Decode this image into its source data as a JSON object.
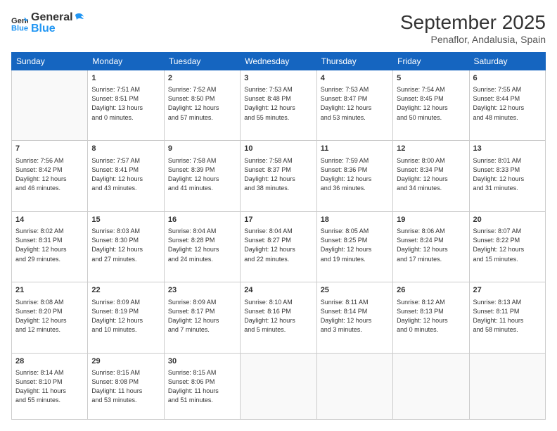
{
  "logo": {
    "general": "General",
    "blue": "Blue"
  },
  "header": {
    "month": "September 2025",
    "location": "Penaflor, Andalusia, Spain"
  },
  "days_of_week": [
    "Sunday",
    "Monday",
    "Tuesday",
    "Wednesday",
    "Thursday",
    "Friday",
    "Saturday"
  ],
  "weeks": [
    [
      {
        "day": "",
        "info": ""
      },
      {
        "day": "1",
        "info": "Sunrise: 7:51 AM\nSunset: 8:51 PM\nDaylight: 13 hours\nand 0 minutes."
      },
      {
        "day": "2",
        "info": "Sunrise: 7:52 AM\nSunset: 8:50 PM\nDaylight: 12 hours\nand 57 minutes."
      },
      {
        "day": "3",
        "info": "Sunrise: 7:53 AM\nSunset: 8:48 PM\nDaylight: 12 hours\nand 55 minutes."
      },
      {
        "day": "4",
        "info": "Sunrise: 7:53 AM\nSunset: 8:47 PM\nDaylight: 12 hours\nand 53 minutes."
      },
      {
        "day": "5",
        "info": "Sunrise: 7:54 AM\nSunset: 8:45 PM\nDaylight: 12 hours\nand 50 minutes."
      },
      {
        "day": "6",
        "info": "Sunrise: 7:55 AM\nSunset: 8:44 PM\nDaylight: 12 hours\nand 48 minutes."
      }
    ],
    [
      {
        "day": "7",
        "info": "Sunrise: 7:56 AM\nSunset: 8:42 PM\nDaylight: 12 hours\nand 46 minutes."
      },
      {
        "day": "8",
        "info": "Sunrise: 7:57 AM\nSunset: 8:41 PM\nDaylight: 12 hours\nand 43 minutes."
      },
      {
        "day": "9",
        "info": "Sunrise: 7:58 AM\nSunset: 8:39 PM\nDaylight: 12 hours\nand 41 minutes."
      },
      {
        "day": "10",
        "info": "Sunrise: 7:58 AM\nSunset: 8:37 PM\nDaylight: 12 hours\nand 38 minutes."
      },
      {
        "day": "11",
        "info": "Sunrise: 7:59 AM\nSunset: 8:36 PM\nDaylight: 12 hours\nand 36 minutes."
      },
      {
        "day": "12",
        "info": "Sunrise: 8:00 AM\nSunset: 8:34 PM\nDaylight: 12 hours\nand 34 minutes."
      },
      {
        "day": "13",
        "info": "Sunrise: 8:01 AM\nSunset: 8:33 PM\nDaylight: 12 hours\nand 31 minutes."
      }
    ],
    [
      {
        "day": "14",
        "info": "Sunrise: 8:02 AM\nSunset: 8:31 PM\nDaylight: 12 hours\nand 29 minutes."
      },
      {
        "day": "15",
        "info": "Sunrise: 8:03 AM\nSunset: 8:30 PM\nDaylight: 12 hours\nand 27 minutes."
      },
      {
        "day": "16",
        "info": "Sunrise: 8:04 AM\nSunset: 8:28 PM\nDaylight: 12 hours\nand 24 minutes."
      },
      {
        "day": "17",
        "info": "Sunrise: 8:04 AM\nSunset: 8:27 PM\nDaylight: 12 hours\nand 22 minutes."
      },
      {
        "day": "18",
        "info": "Sunrise: 8:05 AM\nSunset: 8:25 PM\nDaylight: 12 hours\nand 19 minutes."
      },
      {
        "day": "19",
        "info": "Sunrise: 8:06 AM\nSunset: 8:24 PM\nDaylight: 12 hours\nand 17 minutes."
      },
      {
        "day": "20",
        "info": "Sunrise: 8:07 AM\nSunset: 8:22 PM\nDaylight: 12 hours\nand 15 minutes."
      }
    ],
    [
      {
        "day": "21",
        "info": "Sunrise: 8:08 AM\nSunset: 8:20 PM\nDaylight: 12 hours\nand 12 minutes."
      },
      {
        "day": "22",
        "info": "Sunrise: 8:09 AM\nSunset: 8:19 PM\nDaylight: 12 hours\nand 10 minutes."
      },
      {
        "day": "23",
        "info": "Sunrise: 8:09 AM\nSunset: 8:17 PM\nDaylight: 12 hours\nand 7 minutes."
      },
      {
        "day": "24",
        "info": "Sunrise: 8:10 AM\nSunset: 8:16 PM\nDaylight: 12 hours\nand 5 minutes."
      },
      {
        "day": "25",
        "info": "Sunrise: 8:11 AM\nSunset: 8:14 PM\nDaylight: 12 hours\nand 3 minutes."
      },
      {
        "day": "26",
        "info": "Sunrise: 8:12 AM\nSunset: 8:13 PM\nDaylight: 12 hours\nand 0 minutes."
      },
      {
        "day": "27",
        "info": "Sunrise: 8:13 AM\nSunset: 8:11 PM\nDaylight: 11 hours\nand 58 minutes."
      }
    ],
    [
      {
        "day": "28",
        "info": "Sunrise: 8:14 AM\nSunset: 8:10 PM\nDaylight: 11 hours\nand 55 minutes."
      },
      {
        "day": "29",
        "info": "Sunrise: 8:15 AM\nSunset: 8:08 PM\nDaylight: 11 hours\nand 53 minutes."
      },
      {
        "day": "30",
        "info": "Sunrise: 8:15 AM\nSunset: 8:06 PM\nDaylight: 11 hours\nand 51 minutes."
      },
      {
        "day": "",
        "info": ""
      },
      {
        "day": "",
        "info": ""
      },
      {
        "day": "",
        "info": ""
      },
      {
        "day": "",
        "info": ""
      }
    ]
  ]
}
